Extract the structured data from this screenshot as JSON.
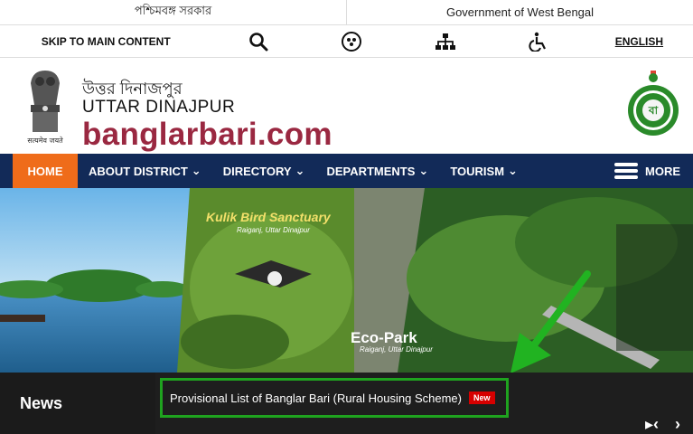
{
  "topbar": {
    "left": "পশ্চিমবঙ্গ সরকার",
    "right": "Government of West Bengal"
  },
  "toolbar": {
    "skip": "SKIP TO MAIN CONTENT",
    "icons": [
      "search-icon",
      "social-icon",
      "sitemap-icon",
      "accessibility-icon"
    ],
    "language": "ENGLISH"
  },
  "header": {
    "title_bn": "উত্তর দিনাজপুর",
    "title_en": "UTTAR DINAJPUR",
    "site": "banglarbari.com",
    "emblem_motto": "सत्यमेव जयते"
  },
  "nav": {
    "home": "HOME",
    "items": [
      "ABOUT DISTRICT",
      "DIRECTORY",
      "DEPARTMENTS",
      "TOURISM"
    ],
    "more": "MORE"
  },
  "hero": {
    "caption1": "Kulik Bird Sanctuary",
    "caption1_sub": "Raiganj, Uttar Dinajpur",
    "caption2": "Eco-Park",
    "caption2_sub": "Raiganj, Uttar Dinajpur"
  },
  "news": {
    "label": "News",
    "headline": "Provisional List of Banglar Bari (Rural Housing Scheme)",
    "badge": "New"
  },
  "colors": {
    "nav_bg": "#122a58",
    "home_bg": "#ef6c1a",
    "site": "#9a2841",
    "highlight": "#1fa31f"
  }
}
